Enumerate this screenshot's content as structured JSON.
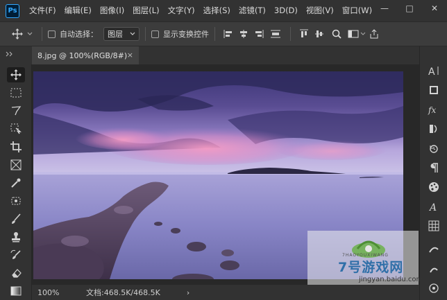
{
  "app": {
    "logo_text": "Ps"
  },
  "menu": [
    "文件(F)",
    "编辑(E)",
    "图像(I)",
    "图层(L)",
    "文字(Y)",
    "选择(S)",
    "滤镜(T)",
    "3D(D)",
    "视图(V)",
    "窗口(W)"
  ],
  "window_controls": {
    "minimize": "—",
    "maximize": "□",
    "close": "✕"
  },
  "options": {
    "auto_select_label": "自动选择：",
    "layer_select_value": "图层",
    "show_transform_label": "显示变换控件"
  },
  "document": {
    "tab_title": "8.jpg @ 100%(RGB/8#)",
    "close_glyph": "×"
  },
  "status": {
    "zoom": "100%",
    "doc_info": "文档:468.5K/468.5K",
    "arrow": "›"
  },
  "watermark": {
    "brand": "7号游戏网",
    "brand_en": "7HAOYOUXIWANG",
    "domain": "jingyan.baidu.com"
  },
  "colors": {
    "accent": "#31a8ff",
    "menu_bg": "#323232",
    "canvas_bg": "#282828"
  }
}
